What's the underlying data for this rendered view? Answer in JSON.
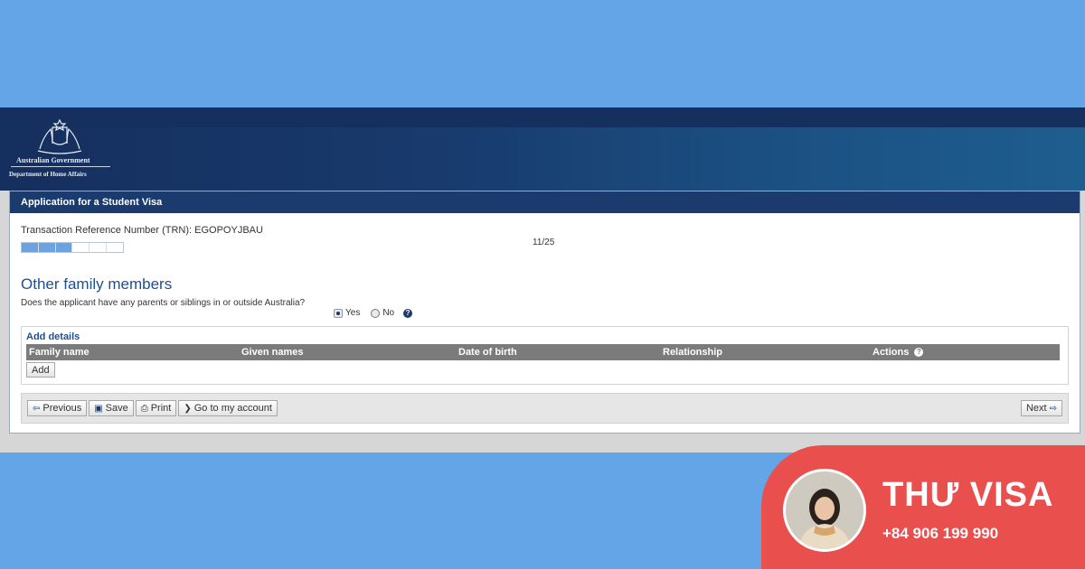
{
  "banner": {
    "org_line1": "Australian Government",
    "org_line2": "Department of Home Affairs"
  },
  "form": {
    "title": "Application for a Student Visa",
    "trn_text": "Transaction Reference Number (TRN): EGOPOYJBAU",
    "step_text": "11/25",
    "progress": {
      "current": 11,
      "total": 25
    },
    "heading": "Other family members",
    "question": "Does the applicant have any parents or siblings in or outside Australia?",
    "options": [
      {
        "label": "Yes",
        "selected": true
      },
      {
        "label": "No",
        "selected": false
      }
    ],
    "help_glyph": "?",
    "details": {
      "label": "Add details",
      "columns": [
        "Family name",
        "Given names",
        "Date of birth",
        "Relationship",
        "Actions"
      ],
      "add_label": "Add"
    },
    "nav": {
      "previous_label": "Previous",
      "save_label": "Save",
      "print_label": "Print",
      "account_label": "Go to my account",
      "next_label": "Next"
    }
  },
  "brand": {
    "name": "THƯ VISA",
    "phone": "+84 906 199 990"
  },
  "colors": {
    "background": "#64a5e8",
    "header_navy": "#1b3a6d",
    "brand_red": "#e94f4d",
    "heading_blue": "#1f4f8f"
  }
}
